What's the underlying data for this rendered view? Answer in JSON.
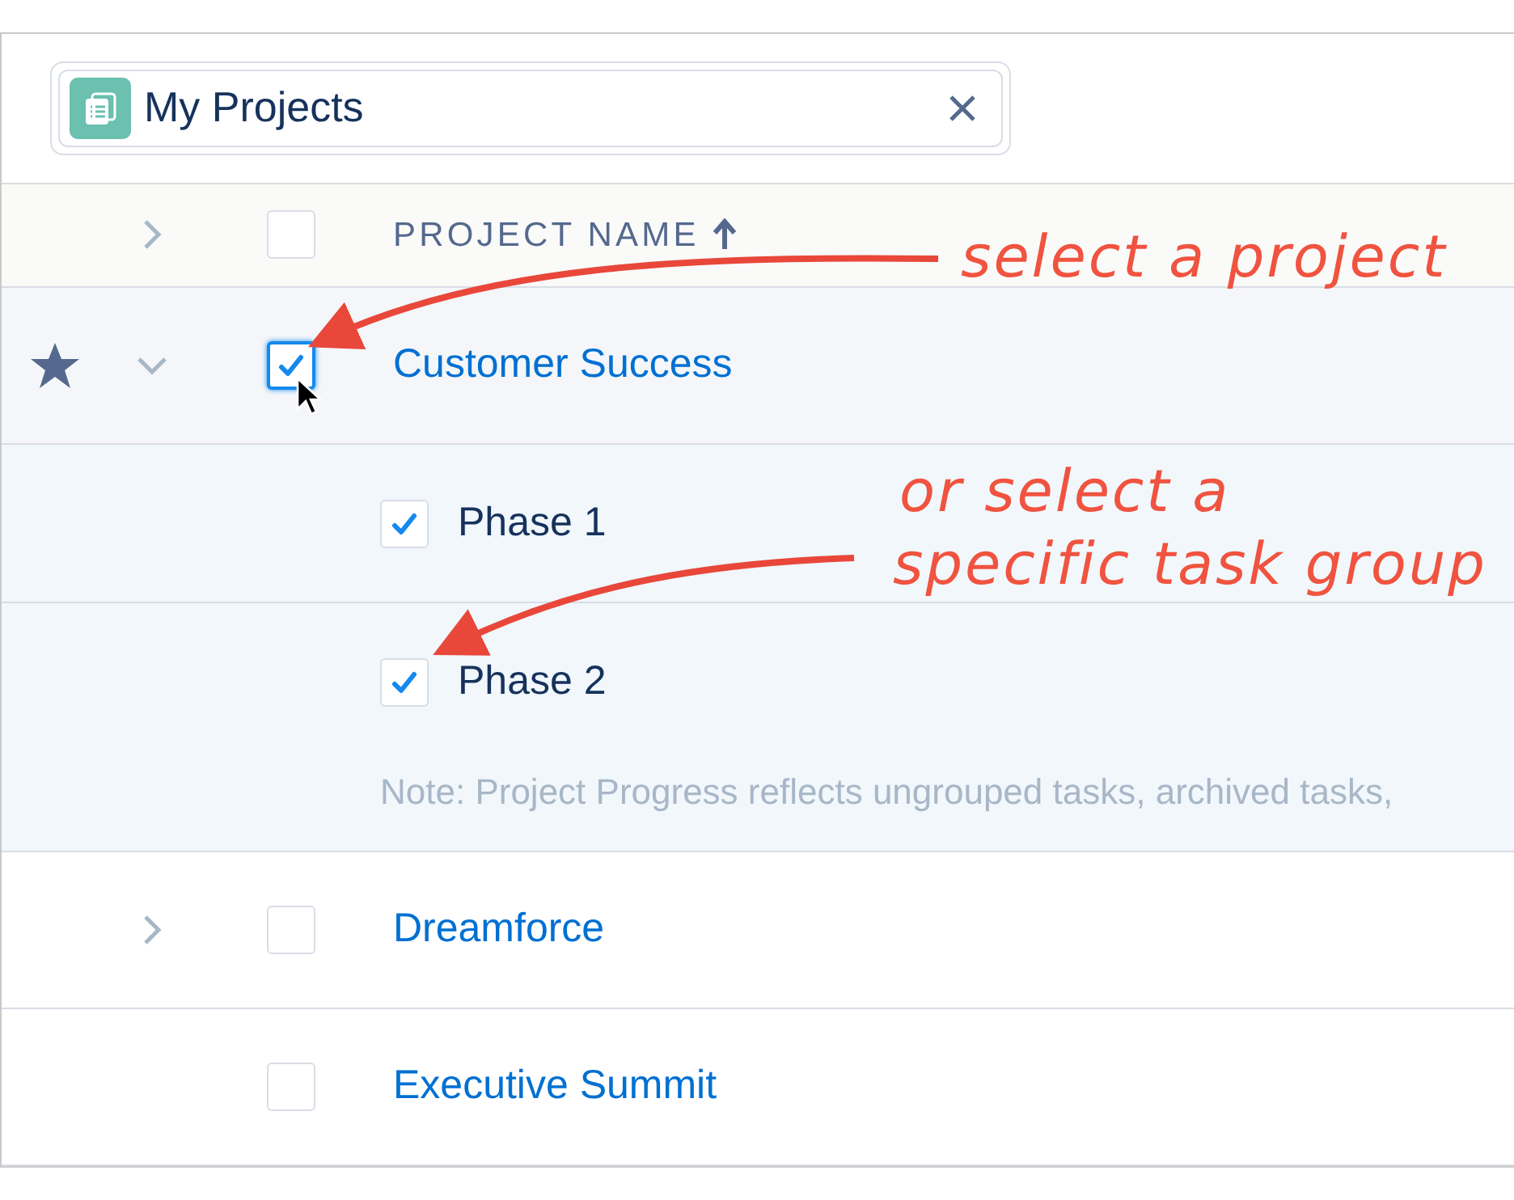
{
  "list_pill": {
    "label": "My Projects"
  },
  "header": {
    "expanded": false,
    "checked": false,
    "column": "PROJECT NAME"
  },
  "rows": [
    {
      "name": "Customer Success",
      "starred": true,
      "expandable": true,
      "expanded": true,
      "checked": true,
      "hovered": true,
      "children": [
        {
          "name": "Phase 1",
          "checked": true
        },
        {
          "name": "Phase 2",
          "checked": true
        }
      ],
      "note": "Note: Project Progress reflects ungrouped tasks, archived tasks,"
    },
    {
      "name": "Dreamforce",
      "starred": false,
      "expandable": true,
      "expanded": false,
      "checked": false,
      "hovered": false
    },
    {
      "name": "Executive Summit",
      "starred": false,
      "expandable": false,
      "checked": false,
      "hovered": false
    }
  ],
  "annotations": [
    {
      "lines": [
        "select a project"
      ]
    },
    {
      "lines": [
        "or select a",
        "specific task group"
      ]
    }
  ]
}
